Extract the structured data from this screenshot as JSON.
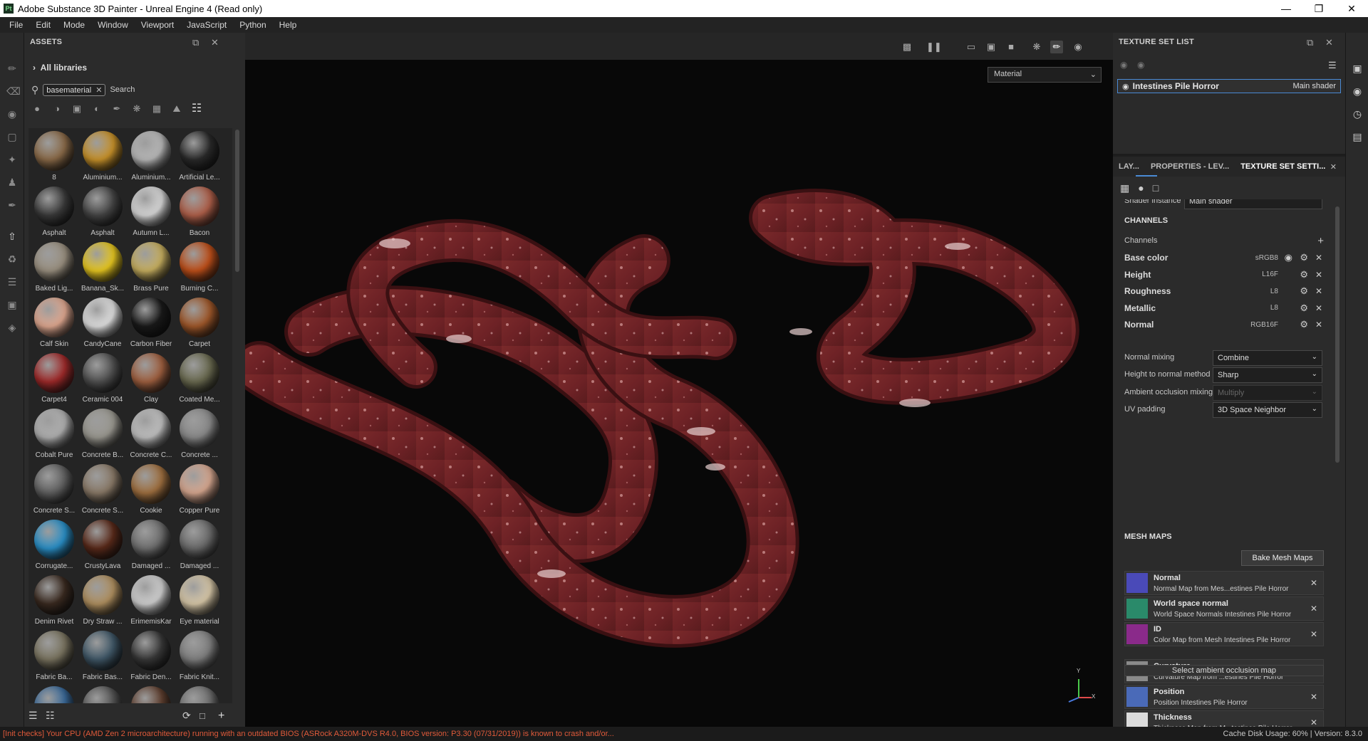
{
  "window": {
    "title": "Adobe Substance 3D Painter - Unreal Engine 4 (Read only)",
    "logo": "Pt"
  },
  "menu": [
    "File",
    "Edit",
    "Mode",
    "Window",
    "Viewport",
    "JavaScript",
    "Python",
    "Help"
  ],
  "assets": {
    "title": "ASSETS",
    "library": "All libraries",
    "filter_tag": "basematerial",
    "search_placeholder": "Search",
    "items": [
      {
        "label": "8",
        "color": "#8a6a48"
      },
      {
        "label": "Aluminium...",
        "color": "#c8922a"
      },
      {
        "label": "Aluminium...",
        "color": "#b8b8b8"
      },
      {
        "label": "Artificial Le...",
        "color": "#2a2a2a"
      },
      {
        "label": "Asphalt",
        "color": "#3a3a3a"
      },
      {
        "label": "Asphalt",
        "color": "#454545"
      },
      {
        "label": "Autumn L...",
        "color": "#d8d8d8"
      },
      {
        "label": "Bacon",
        "color": "#b0604a"
      },
      {
        "label": "Baked Lig...",
        "color": "#9a9080"
      },
      {
        "label": "Banana_Sk...",
        "color": "#e8c820"
      },
      {
        "label": "Brass Pure",
        "color": "#c8b060"
      },
      {
        "label": "Burning C...",
        "color": "#c0501a"
      },
      {
        "label": "Calf Skin",
        "color": "#e0a890"
      },
      {
        "label": "CandyCane",
        "color": "#e0e0e0"
      },
      {
        "label": "Carbon Fiber",
        "color": "#1a1a1a"
      },
      {
        "label": "Carpet",
        "color": "#a0582a"
      },
      {
        "label": "Carpet4",
        "color": "#a02a2a"
      },
      {
        "label": "Ceramic 004",
        "color": "#505050"
      },
      {
        "label": "Clay",
        "color": "#a06040"
      },
      {
        "label": "Coated Me...",
        "color": "#6a6a50"
      },
      {
        "label": "Cobalt Pure",
        "color": "#b0b0b0"
      },
      {
        "label": "Concrete B...",
        "color": "#9a9890"
      },
      {
        "label": "Concrete C...",
        "color": "#c0c0c0"
      },
      {
        "label": "Concrete ...",
        "color": "#8a8a8a"
      },
      {
        "label": "Concrete S...",
        "color": "#606060"
      },
      {
        "label": "Concrete S...",
        "color": "#8a7a68"
      },
      {
        "label": "Cookie",
        "color": "#a07040"
      },
      {
        "label": "Copper Pure",
        "color": "#d8a890"
      },
      {
        "label": "Corrugate...",
        "color": "#2a90c8"
      },
      {
        "label": "CrustyLava",
        "color": "#5a2a1a"
      },
      {
        "label": "Damaged ...",
        "color": "#707070"
      },
      {
        "label": "Damaged ...",
        "color": "#6a6a6a"
      },
      {
        "label": "Denim Rivet",
        "color": "#3a2a20"
      },
      {
        "label": "Dry Straw ...",
        "color": "#b09060"
      },
      {
        "label": "ErimemisKar",
        "color": "#d0d0d0"
      },
      {
        "label": "Eye material",
        "color": "#d8c8a8"
      },
      {
        "label": "Fabric Ba...",
        "color": "#7a7460"
      },
      {
        "label": "Fabric Bas...",
        "color": "#405868"
      },
      {
        "label": "Fabric Den...",
        "color": "#383838"
      },
      {
        "label": "Fabric Knit...",
        "color": "#808080"
      },
      {
        "label": "",
        "color": "#3a6a9a"
      },
      {
        "label": "",
        "color": "#555"
      },
      {
        "label": "",
        "color": "#604030"
      },
      {
        "label": "",
        "color": "#707070"
      }
    ]
  },
  "viewport": {
    "mode_select": "Material",
    "gizmo": {
      "y": "Y",
      "x": "X"
    }
  },
  "texture_set_list": {
    "title": "TEXTURE SET LIST",
    "item": "Intestines Pile Horror",
    "shader": "Main shader"
  },
  "props": {
    "tabs": [
      "LAY...",
      "PROPERTIES - LEV...",
      "TEXTURE SET SETTI..."
    ],
    "shader_instance_label": "Shader instance",
    "shader_instance_value": "Main shader",
    "channels_title": "CHANNELS",
    "channels_label": "Channels",
    "channels": [
      {
        "name": "Base color",
        "format": "sRGB8"
      },
      {
        "name": "Height",
        "format": "L16F"
      },
      {
        "name": "Roughness",
        "format": "L8"
      },
      {
        "name": "Metallic",
        "format": "L8"
      },
      {
        "name": "Normal",
        "format": "RGB16F"
      }
    ],
    "fields": [
      {
        "label": "Normal mixing",
        "value": "Combine",
        "disabled": false
      },
      {
        "label": "Height to normal method",
        "value": "Sharp",
        "disabled": false
      },
      {
        "label": "Ambient occlusion mixing",
        "value": "Multiply",
        "disabled": true
      },
      {
        "label": "UV padding",
        "value": "3D Space Neighbor",
        "disabled": false
      }
    ],
    "mesh_maps_title": "MESH MAPS",
    "bake_button": "Bake Mesh Maps",
    "ao_button": "Select ambient occlusion map",
    "mesh_maps": [
      {
        "name": "Normal",
        "desc": "Normal Map from Mes...estines Pile Horror"
      },
      {
        "name": "World space normal",
        "desc": "World Space Normals Intestines Pile Horror"
      },
      {
        "name": "ID",
        "desc": "Color Map from Mesh Intestines Pile Horror"
      },
      {
        "name": "Curvature",
        "desc": "Curvature Map from ...estines Pile Horror"
      },
      {
        "name": "Position",
        "desc": "Position Intestines Pile Horror"
      },
      {
        "name": "Thickness",
        "desc": "Thickness Map from M...testines Pile Horror"
      }
    ]
  },
  "status": {
    "warning": "[Init checks] Your CPU (AMD Zen 2 microarchitecture) running with an outdated BIOS (ASRock A320M-DVS R4.0, BIOS version: P3.30 (07/31/2019)) is known to crash and/or...",
    "cache": "Cache Disk Usage:  60% | Version: 8.3.0"
  }
}
